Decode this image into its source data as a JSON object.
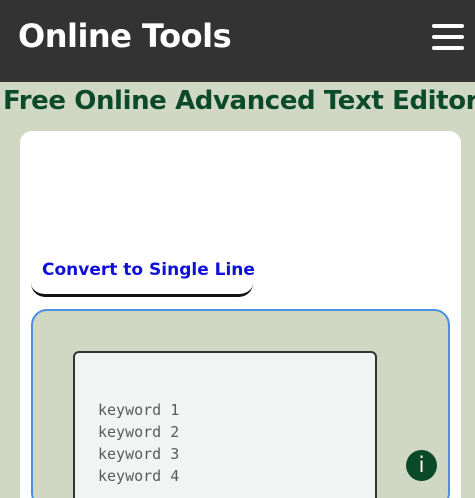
{
  "header": {
    "brand": "Online Tools",
    "menu_icon": "hamburger-menu-icon"
  },
  "page": {
    "title": "Free Online Advanced Text Editor"
  },
  "toolbar": {
    "convert_label": "Convert to Single Line"
  },
  "editor": {
    "lines": [
      "keyword 1",
      "keyword 2",
      "keyword 3",
      "keyword 4"
    ]
  },
  "info": {
    "icon": "info-icon",
    "glyph": "i"
  },
  "colors": {
    "header_bg": "#333333",
    "page_bg": "#d0d8c3",
    "title": "#0b4a28",
    "button_text": "#1010d8",
    "panel_border": "#4a90e2"
  }
}
